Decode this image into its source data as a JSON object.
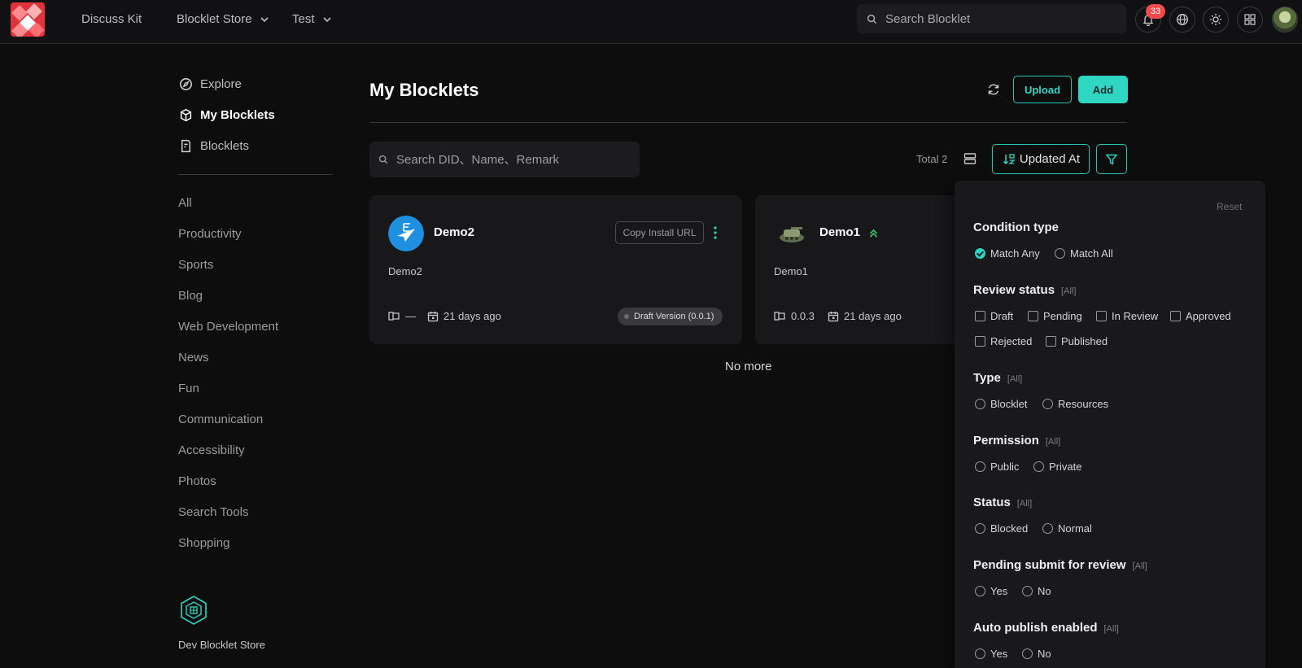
{
  "topbar": {
    "nav": [
      {
        "label": "Discuss Kit",
        "has_dropdown": false
      },
      {
        "label": "Blocklet Store",
        "has_dropdown": true
      },
      {
        "label": "Test",
        "has_dropdown": true
      }
    ],
    "search_placeholder": "Search Blocklet",
    "notification_count": "33",
    "icons": [
      "bell-icon",
      "globe-icon",
      "sun-icon",
      "apps-icon"
    ],
    "brand_color": "#e0323a",
    "accent_color": "#2fd6c2"
  },
  "sidebar": {
    "main": [
      {
        "label": "Explore",
        "icon": "compass-icon",
        "active": false
      },
      {
        "label": "My Blocklets",
        "icon": "cube-icon",
        "active": true
      },
      {
        "label": "Blocklets",
        "icon": "document-icon",
        "active": false
      }
    ],
    "categories": [
      "All",
      "Productivity",
      "Sports",
      "Blog",
      "Web Development",
      "News",
      "Fun",
      "Communication",
      "Accessibility",
      "Photos",
      "Search Tools",
      "Shopping"
    ],
    "footer_label": "Dev Blocklet Store"
  },
  "main": {
    "title": "My Blocklets",
    "upload_label": "Upload",
    "add_label": "Add",
    "search_placeholder": "Search DID、Name、Remark",
    "total_label": "Total 2",
    "sort_label": "Updated At",
    "no_more": "No more",
    "cards": [
      {
        "name": "Demo2",
        "description": "Demo2",
        "version": "—",
        "updated": "21 days ago",
        "copy_label": "Copy Install URL",
        "status_chip": "Draft Version (0.0.1)"
      },
      {
        "name": "Demo1",
        "description": "Demo1",
        "version": "0.0.3",
        "updated": "21 days ago"
      }
    ]
  },
  "filter": {
    "reset_label": "Reset",
    "all_tag": "[All]",
    "condition_type": {
      "title": "Condition type",
      "options": [
        "Match Any",
        "Match All"
      ],
      "selected": "Match Any"
    },
    "review_status": {
      "title": "Review status",
      "options": [
        "Draft",
        "Pending",
        "In Review",
        "Approved",
        "Rejected",
        "Published"
      ]
    },
    "type": {
      "title": "Type",
      "options": [
        "Blocklet",
        "Resources"
      ]
    },
    "permission": {
      "title": "Permission",
      "options": [
        "Public",
        "Private"
      ]
    },
    "status": {
      "title": "Status",
      "options": [
        "Blocked",
        "Normal"
      ]
    },
    "pending_submit": {
      "title": "Pending submit for review",
      "options": [
        "Yes",
        "No"
      ]
    },
    "auto_publish": {
      "title": "Auto publish enabled",
      "options": [
        "Yes",
        "No"
      ]
    }
  }
}
